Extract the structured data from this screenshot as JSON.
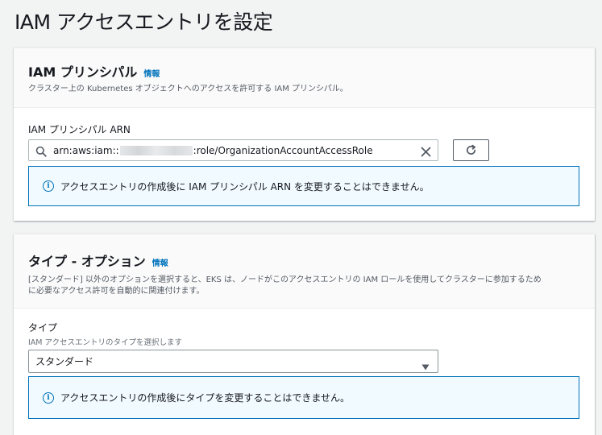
{
  "page": {
    "title": "IAM アクセスエントリを設定"
  },
  "principal_panel": {
    "title": "IAM プリンシパル",
    "info_label": "情報",
    "description": "クラスター上の Kubernetes オブジェクトへのアクセスを許可する IAM プリンシパル。",
    "field_label": "IAM プリンシパル ARN",
    "arn_prefix": "arn:aws:iam::",
    "arn_suffix": ":role/OrganizationAccountAccessRole",
    "alert_text": "アクセスエントリの作成後に IAM プリンシパル ARN を変更することはできません。",
    "icons": {
      "search": "search-icon",
      "clear": "close-icon",
      "refresh": "refresh-icon",
      "info": "info-icon"
    }
  },
  "type_panel": {
    "title": "タイプ - オプション",
    "info_label": "情報",
    "description_line1": "[スタンダード] 以外のオプションを選択すると、EKS は、ノードがこのアクセスエントリの IAM ロールを使用してクラスターに参加するため",
    "description_line2": "に必要なアクセス許可を自動的に関連付けます。",
    "field_label": "タイプ",
    "field_sub": "IAM アクセスエントリのタイプを選択します",
    "selected": "スタンダード",
    "alert_text": "アクセスエントリの作成後にタイプを変更することはできません。",
    "icons": {
      "dropdown": "caret-down-icon",
      "info": "info-icon"
    }
  },
  "colors": {
    "accent": "#0073bb",
    "alert_bg": "#f1faff",
    "background": "#f2f3f3"
  }
}
